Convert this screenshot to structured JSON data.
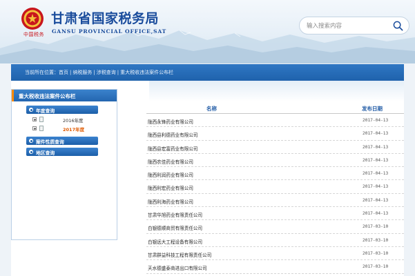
{
  "header": {
    "title_cn": "甘肃省国家税务局",
    "title_en": "GANSU PROVINCIAL OFFICE,SAT",
    "seal_text": "中国税务",
    "search_placeholder": "输入搜索内容"
  },
  "breadcrumb": {
    "prefix": "当前所在位置：",
    "items": [
      "首页",
      "纳税服务",
      "涉税查询",
      "重大税收违法案件公布栏"
    ]
  },
  "sidebar": {
    "title": "重大税收违法案件公布栏",
    "year_button": "年度查询",
    "years": [
      {
        "label": "2016年度",
        "active": false
      },
      {
        "label": "2017年度",
        "active": true
      }
    ],
    "nature_button": "案件性质查询",
    "region_button": "地区查询"
  },
  "table": {
    "col_name": "名称",
    "col_date": "发布日期",
    "rows": [
      {
        "name": "陇西永锋药业有限公司",
        "date": "2017-04-13"
      },
      {
        "name": "陇西县利德药业有限公司",
        "date": "2017-04-13"
      },
      {
        "name": "陇西县宏富药业有限公司",
        "date": "2017-04-13"
      },
      {
        "name": "陇西农佳药业有限公司",
        "date": "2017-04-13"
      },
      {
        "name": "陇西利润药业有限公司",
        "date": "2017-04-13"
      },
      {
        "name": "陇西利宏药业有限公司",
        "date": "2017-04-13"
      },
      {
        "name": "陇西利海药业有限公司",
        "date": "2017-04-13"
      },
      {
        "name": "甘肃华旭药业有限责任公司",
        "date": "2017-04-13"
      },
      {
        "name": "白银德顺商贸有限责任公司",
        "date": "2017-03-10"
      },
      {
        "name": "白银远大工程设备有限公司",
        "date": "2017-03-10"
      },
      {
        "name": "甘肃群益科技工程有限责任公司",
        "date": "2017-03-10"
      },
      {
        "name": "天水德盛泰商进出口有限公司",
        "date": "2017-03-10"
      }
    ]
  },
  "colors": {
    "brand_blue": "#1a4c9c",
    "bar_blue": "#2466b0",
    "accent_orange": "#ff8b00",
    "seal_red": "#c8161d"
  }
}
